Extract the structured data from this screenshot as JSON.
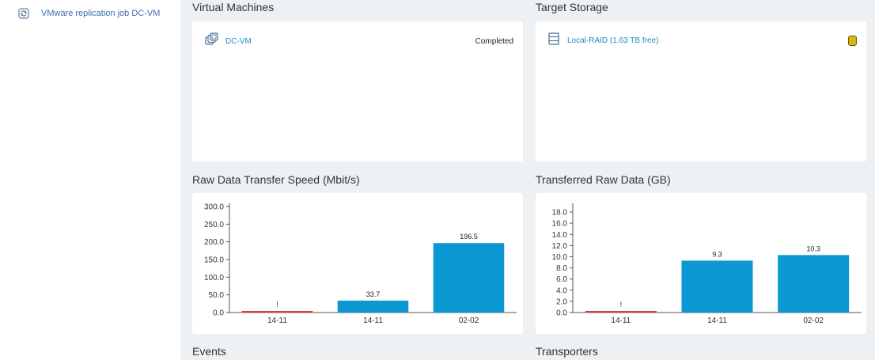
{
  "sidebar": {
    "job": {
      "label": "VMware replication job DC-VM",
      "icon": "refresh-cycle-icon"
    }
  },
  "sections": {
    "virtual_machines": {
      "title": "Virtual Machines",
      "vm": {
        "name": "DC-VM",
        "status": "Completed",
        "icon": "vm-stack-icon"
      }
    },
    "target_storage": {
      "title": "Target Storage",
      "storage": {
        "name": "Local-RAID (1.63 TB free)",
        "icon": "storage-list-icon",
        "status_color": "#d6b80e"
      }
    },
    "speed": {
      "title": "Raw Data Transfer Speed (Mbit/s)"
    },
    "transferred": {
      "title": "Transferred Raw Data (GB)"
    },
    "events": {
      "title": "Events"
    },
    "transporters": {
      "title": "Transporters"
    }
  },
  "colors": {
    "bar": "#0c98d3",
    "failed_bar": "#e13a3a",
    "link": "#1f8bc7",
    "sidebar_link": "#3f6fa8"
  },
  "chart_data": [
    {
      "type": "bar",
      "title": "Raw Data Transfer Speed (Mbit/s)",
      "categories": [
        "14-11",
        "14-11",
        "02-02"
      ],
      "values": [
        3,
        33.7,
        196.5
      ],
      "bar_labels": [
        "!",
        "33.7",
        "196.5"
      ],
      "bar_status": [
        "failed",
        "ok",
        "ok"
      ],
      "ylim": [
        0,
        300
      ],
      "yticks": [
        "0.0",
        "50.0",
        "100.0",
        "150.0",
        "200.0",
        "250.0",
        "300.0"
      ],
      "ytick_values": [
        0,
        50,
        100,
        150,
        200,
        250,
        300
      ]
    },
    {
      "type": "bar",
      "title": "Transferred Raw Data (GB)",
      "categories": [
        "14-11",
        "14-11",
        "02-02"
      ],
      "values": [
        0.2,
        9.3,
        10.3
      ],
      "bar_labels": [
        "!",
        "9.3",
        "10.3"
      ],
      "bar_status": [
        "failed",
        "ok",
        "ok"
      ],
      "ylim": [
        0,
        19
      ],
      "yticks": [
        "0.0",
        "2.0",
        "4.0",
        "6.0",
        "8.0",
        "10.0",
        "12.0",
        "14.0",
        "16.0",
        "18.0"
      ],
      "ytick_values": [
        0,
        2,
        4,
        6,
        8,
        10,
        12,
        14,
        16,
        18
      ]
    }
  ]
}
